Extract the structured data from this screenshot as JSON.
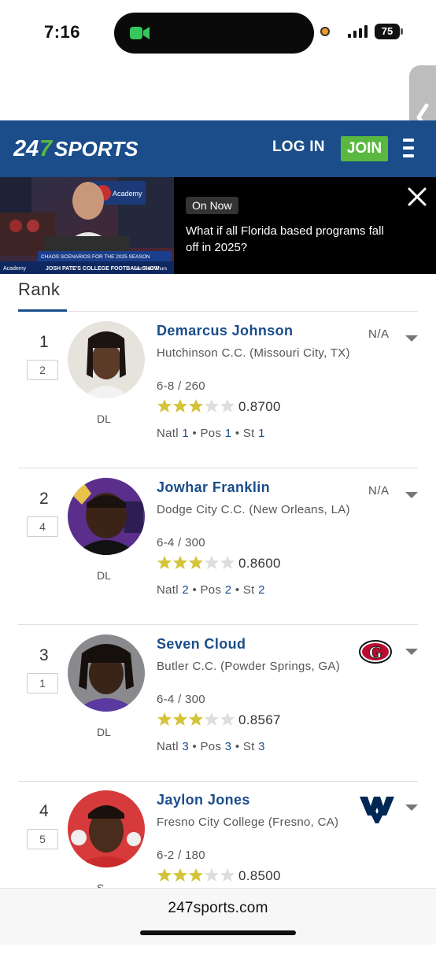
{
  "status": {
    "time": "7:16",
    "battery": "75"
  },
  "header": {
    "logo": "247SPORTS",
    "login": "LOG IN",
    "join": "JOIN"
  },
  "promo": {
    "badge": "On Now",
    "text": "What if all Florida based programs fall off in 2025?",
    "thumb_caption1": "CHAOS SCENARIOS FOR THE 2025 SEASON",
    "thumb_caption2": "JOSH PATE'S COLLEGE FOOTBALL SHOW",
    "thumb_sponsor": "Academy",
    "thumb_days": "Sun  Tues  Thurs"
  },
  "table": {
    "heading": "Rank"
  },
  "players": [
    {
      "rank": "1",
      "prev": "2",
      "name": "Demarcus Johnson",
      "school": "Hutchinson C.C. (Missouri City, TX)",
      "hw": "6-8 / 260",
      "pos": "DL",
      "stars": 3,
      "score": "0.8700",
      "natl": "1",
      "posrank": "1",
      "st": "1",
      "commit": "N/A",
      "team": null
    },
    {
      "rank": "2",
      "prev": "4",
      "name": "Jowhar Franklin",
      "school": "Dodge City C.C. (New Orleans, LA)",
      "hw": "6-4 / 300",
      "pos": "DL",
      "stars": 3,
      "score": "0.8600",
      "natl": "2",
      "posrank": "2",
      "st": "2",
      "commit": "N/A",
      "team": null
    },
    {
      "rank": "3",
      "prev": "1",
      "name": "Seven Cloud",
      "school": "Butler C.C. (Powder Springs, GA)",
      "hw": "6-4 / 300",
      "pos": "DL",
      "stars": 3,
      "score": "0.8567",
      "natl": "3",
      "posrank": "3",
      "st": "3",
      "commit": "",
      "team": "georgia-logo"
    },
    {
      "rank": "4",
      "prev": "5",
      "name": "Jaylon Jones",
      "school": "Fresno City College (Fresno, CA)",
      "hw": "6-2 / 180",
      "pos": "S",
      "stars": 3,
      "score": "0.8500",
      "natl": "",
      "posrank": "",
      "st": "",
      "commit": "",
      "team": "west-virginia-logo"
    }
  ],
  "labels": {
    "natl": "Natl",
    "pos": "Pos",
    "st": "St"
  },
  "footer": {
    "url": "247sports.com"
  },
  "colors": {
    "brand": "#1a4d8a",
    "join": "#5ab840",
    "star": "#d4c43a"
  }
}
